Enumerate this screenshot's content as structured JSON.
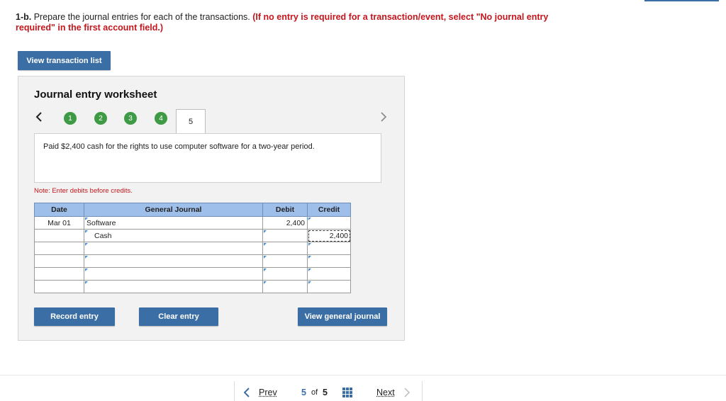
{
  "instruction": {
    "lead": "1-b.",
    "text": " Prepare the journal entries for each of the transactions.",
    "note": " (If no entry is required for a transaction/event, select \"No journal entry required\" in the first account field.)"
  },
  "view_transaction_list": "View transaction list",
  "worksheet": {
    "title": "Journal entry worksheet",
    "steps": [
      "1",
      "2",
      "3",
      "4"
    ],
    "active_step": "5",
    "description": "Paid $2,400 cash for the rights to use computer software for a two-year period.",
    "note": "Note: Enter debits before credits."
  },
  "journal": {
    "headers": {
      "date": "Date",
      "account": "General Journal",
      "debit": "Debit",
      "credit": "Credit"
    },
    "rows": [
      {
        "date": "Mar 01",
        "account": "Software",
        "debit": "2,400",
        "credit": ""
      },
      {
        "date": "",
        "account": "Cash",
        "debit": "",
        "credit": "2,400"
      },
      {
        "date": "",
        "account": "",
        "debit": "",
        "credit": ""
      },
      {
        "date": "",
        "account": "",
        "debit": "",
        "credit": ""
      },
      {
        "date": "",
        "account": "",
        "debit": "",
        "credit": ""
      },
      {
        "date": "",
        "account": "",
        "debit": "",
        "credit": ""
      }
    ]
  },
  "buttons": {
    "record": "Record entry",
    "clear": "Clear entry",
    "view_journal": "View general journal"
  },
  "pager": {
    "prev": "Prev",
    "current": "5",
    "of": "of",
    "total": "5",
    "next": "Next"
  },
  "colors": {
    "accent": "#3a6ea5",
    "step_done": "#3f9a46",
    "warning": "#c4161c",
    "header_bg": "#9dbfea"
  },
  "icons": [
    "chevron-left-icon",
    "chevron-right-icon",
    "grid-icon"
  ]
}
